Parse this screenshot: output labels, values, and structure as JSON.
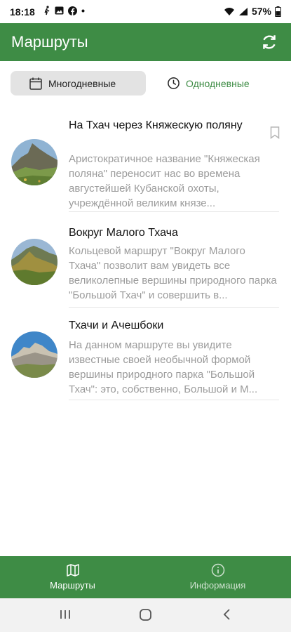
{
  "status_bar": {
    "time": "18:18",
    "battery": "57%"
  },
  "app_bar": {
    "title": "Маршруты",
    "refresh_icon": "refresh-icon"
  },
  "tabs": [
    {
      "label": "Многодневные",
      "icon": "calendar-icon",
      "selected": true
    },
    {
      "label": "Однодневные",
      "icon": "clock-icon",
      "selected": false
    }
  ],
  "routes": [
    {
      "title": "На Тхач через Княжескую поляну",
      "description": "Аристократичное название \"Княжеская поляна\" переносит нас во времена августейшей Кубанской охоты, учреждённой великим князе...",
      "bookmark": true
    },
    {
      "title": "Вокруг Малого Тхача",
      "description": "Кольцевой маршрут \"Вокруг Малого Тхача\" позволит вам увидеть все великолепные вершины природного парка \"Большой Тхач\" и совершить в...",
      "bookmark": false
    },
    {
      "title": "Тхачи и Ачешбоки",
      "description": "На данном маршруте вы увидите известные своей необычной формой вершины природного парка \"Большой Тхач\": это, собственно, Большой и М...",
      "bookmark": false
    }
  ],
  "bottom_nav": [
    {
      "label": "Маршруты",
      "icon": "map-icon",
      "active": true
    },
    {
      "label": "Информация",
      "icon": "info-icon",
      "active": false
    }
  ],
  "colors": {
    "primary": "#3e8c45",
    "tab_selected_bg": "#e3e3e3",
    "description_text": "#9b9b9b"
  }
}
